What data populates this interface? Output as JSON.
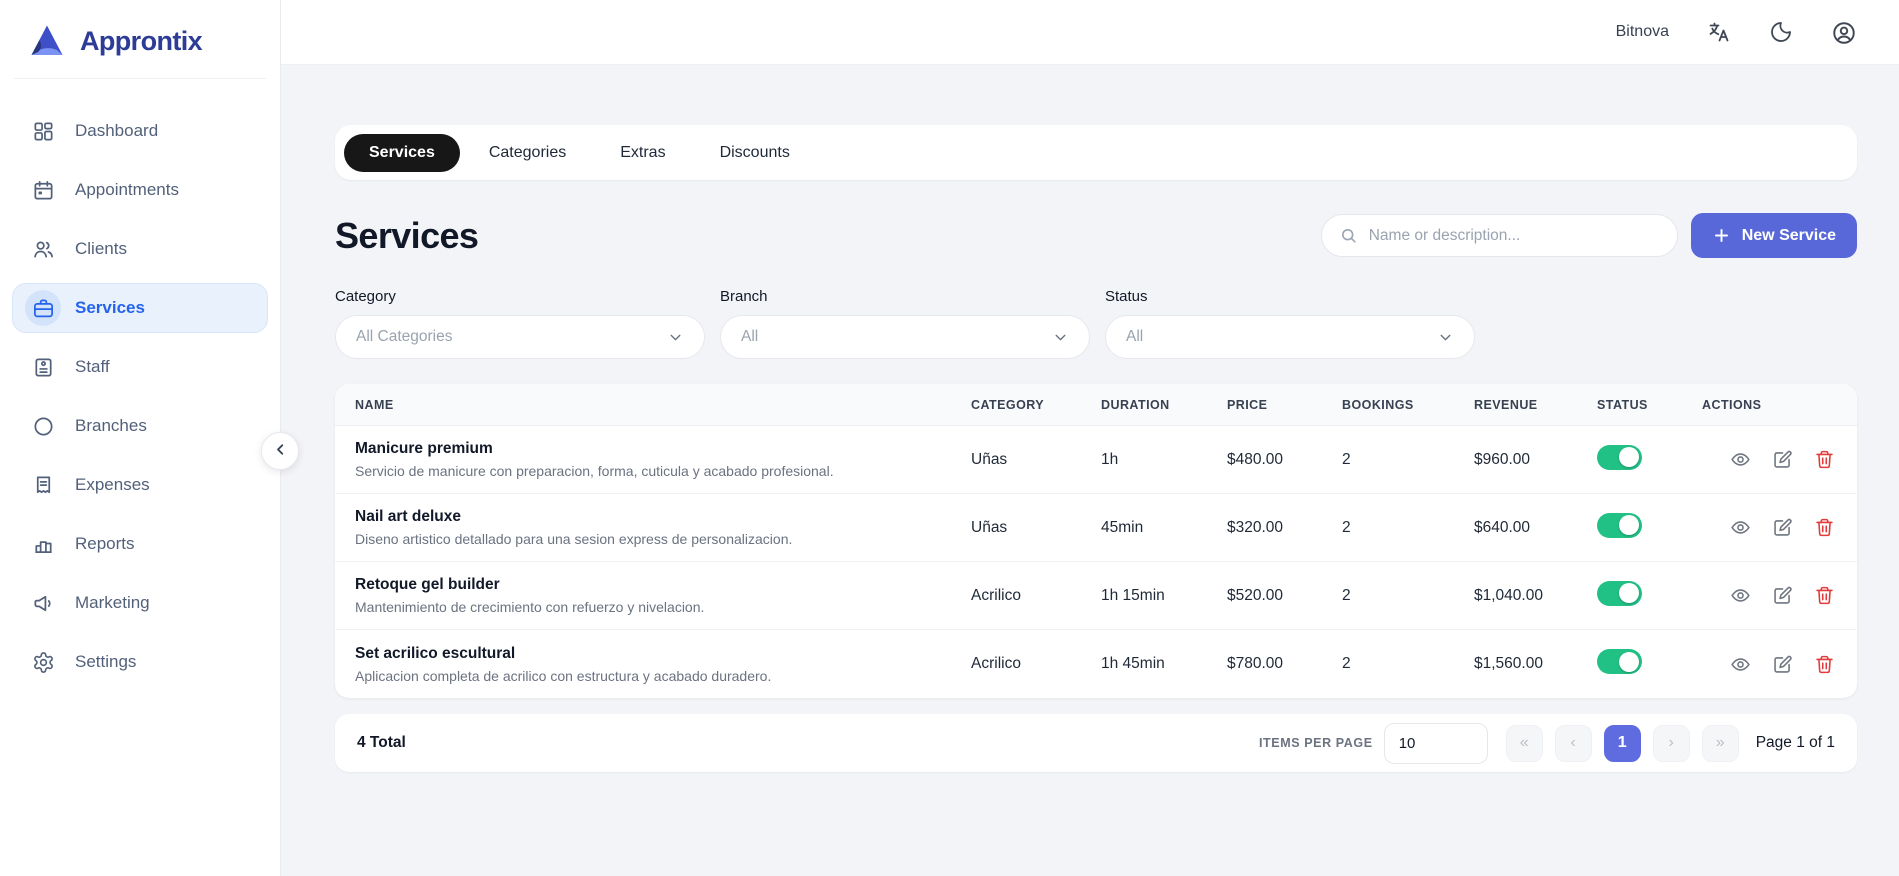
{
  "colors": {
    "accent": "#5968d9",
    "pagination_active": "#5f6ce0",
    "sidebar_active_text": "#2563eb",
    "sidebar_active_bg": "#e9f1fd",
    "toggle_on": "#21c186",
    "danger": "#e23b3b",
    "brand": "#2d3c96",
    "tab_active_bg": "#171717"
  },
  "brand": {
    "name": "Approntix",
    "logo_icon": "triangle-logo-icon"
  },
  "header": {
    "workspace_label": "Bitnova",
    "icons": [
      "translate-icon",
      "moon-icon",
      "user-circle-icon"
    ]
  },
  "sidebar": {
    "collapse_icon": "chevron-left-icon",
    "items": [
      {
        "label": "Dashboard",
        "icon": "dashboard-icon",
        "active": false
      },
      {
        "label": "Appointments",
        "icon": "calendar-icon",
        "active": false
      },
      {
        "label": "Clients",
        "icon": "clients-icon",
        "active": false
      },
      {
        "label": "Services",
        "icon": "briefcase-icon",
        "active": true
      },
      {
        "label": "Staff",
        "icon": "staff-icon",
        "active": false
      },
      {
        "label": "Branches",
        "icon": "circle-icon",
        "active": false
      },
      {
        "label": "Expenses",
        "icon": "receipt-icon",
        "active": false
      },
      {
        "label": "Reports",
        "icon": "bar-chart-icon",
        "active": false
      },
      {
        "label": "Marketing",
        "icon": "megaphone-icon",
        "active": false
      },
      {
        "label": "Settings",
        "icon": "gear-icon",
        "active": false
      }
    ]
  },
  "tabs": [
    {
      "label": "Services",
      "active": true
    },
    {
      "label": "Categories",
      "active": false
    },
    {
      "label": "Extras",
      "active": false
    },
    {
      "label": "Discounts",
      "active": false
    }
  ],
  "page": {
    "title": "Services",
    "search_placeholder": "Name or description...",
    "search_icon": "search-icon",
    "new_service_label": "New Service",
    "new_service_icon": "plus-icon"
  },
  "filters": [
    {
      "label": "Category",
      "value": "All Categories"
    },
    {
      "label": "Branch",
      "value": "All"
    },
    {
      "label": "Status",
      "value": "All"
    }
  ],
  "table": {
    "columns": [
      "NAME",
      "CATEGORY",
      "DURATION",
      "PRICE",
      "BOOKINGS",
      "REVENUE",
      "STATUS",
      "ACTIONS"
    ],
    "action_icons": [
      "eye-icon",
      "edit-icon",
      "trash-icon"
    ],
    "rows": [
      {
        "name": "Manicure premium",
        "description": "Servicio de manicure con preparacion, forma, cuticula y acabado profesional.",
        "category": "Uñas",
        "duration": "1h",
        "price": "$480.00",
        "bookings": "2",
        "revenue": "$960.00",
        "status_on": true
      },
      {
        "name": "Nail art deluxe",
        "description": "Diseno artistico detallado para una sesion express de personalizacion.",
        "category": "Uñas",
        "duration": "45min",
        "price": "$320.00",
        "bookings": "2",
        "revenue": "$640.00",
        "status_on": true
      },
      {
        "name": "Retoque gel builder",
        "description": "Mantenimiento de crecimiento con refuerzo y nivelacion.",
        "category": "Acrilico",
        "duration": "1h 15min",
        "price": "$520.00",
        "bookings": "2",
        "revenue": "$1,040.00",
        "status_on": true
      },
      {
        "name": "Set acrilico escultural",
        "description": "Aplicacion completa de acrilico con estructura y acabado duradero.",
        "category": "Acrilico",
        "duration": "1h 45min",
        "price": "$780.00",
        "bookings": "2",
        "revenue": "$1,560.00",
        "status_on": true
      }
    ]
  },
  "pagination": {
    "total_label": "4 Total",
    "items_per_page_label": "ITEMS PER PAGE",
    "items_per_page_value": "10",
    "first_label": "«",
    "prev_label": "‹",
    "next_label": "›",
    "last_label": "»",
    "pages": [
      {
        "label": "1",
        "active": true
      }
    ],
    "page_info": "Page 1 of 1"
  }
}
